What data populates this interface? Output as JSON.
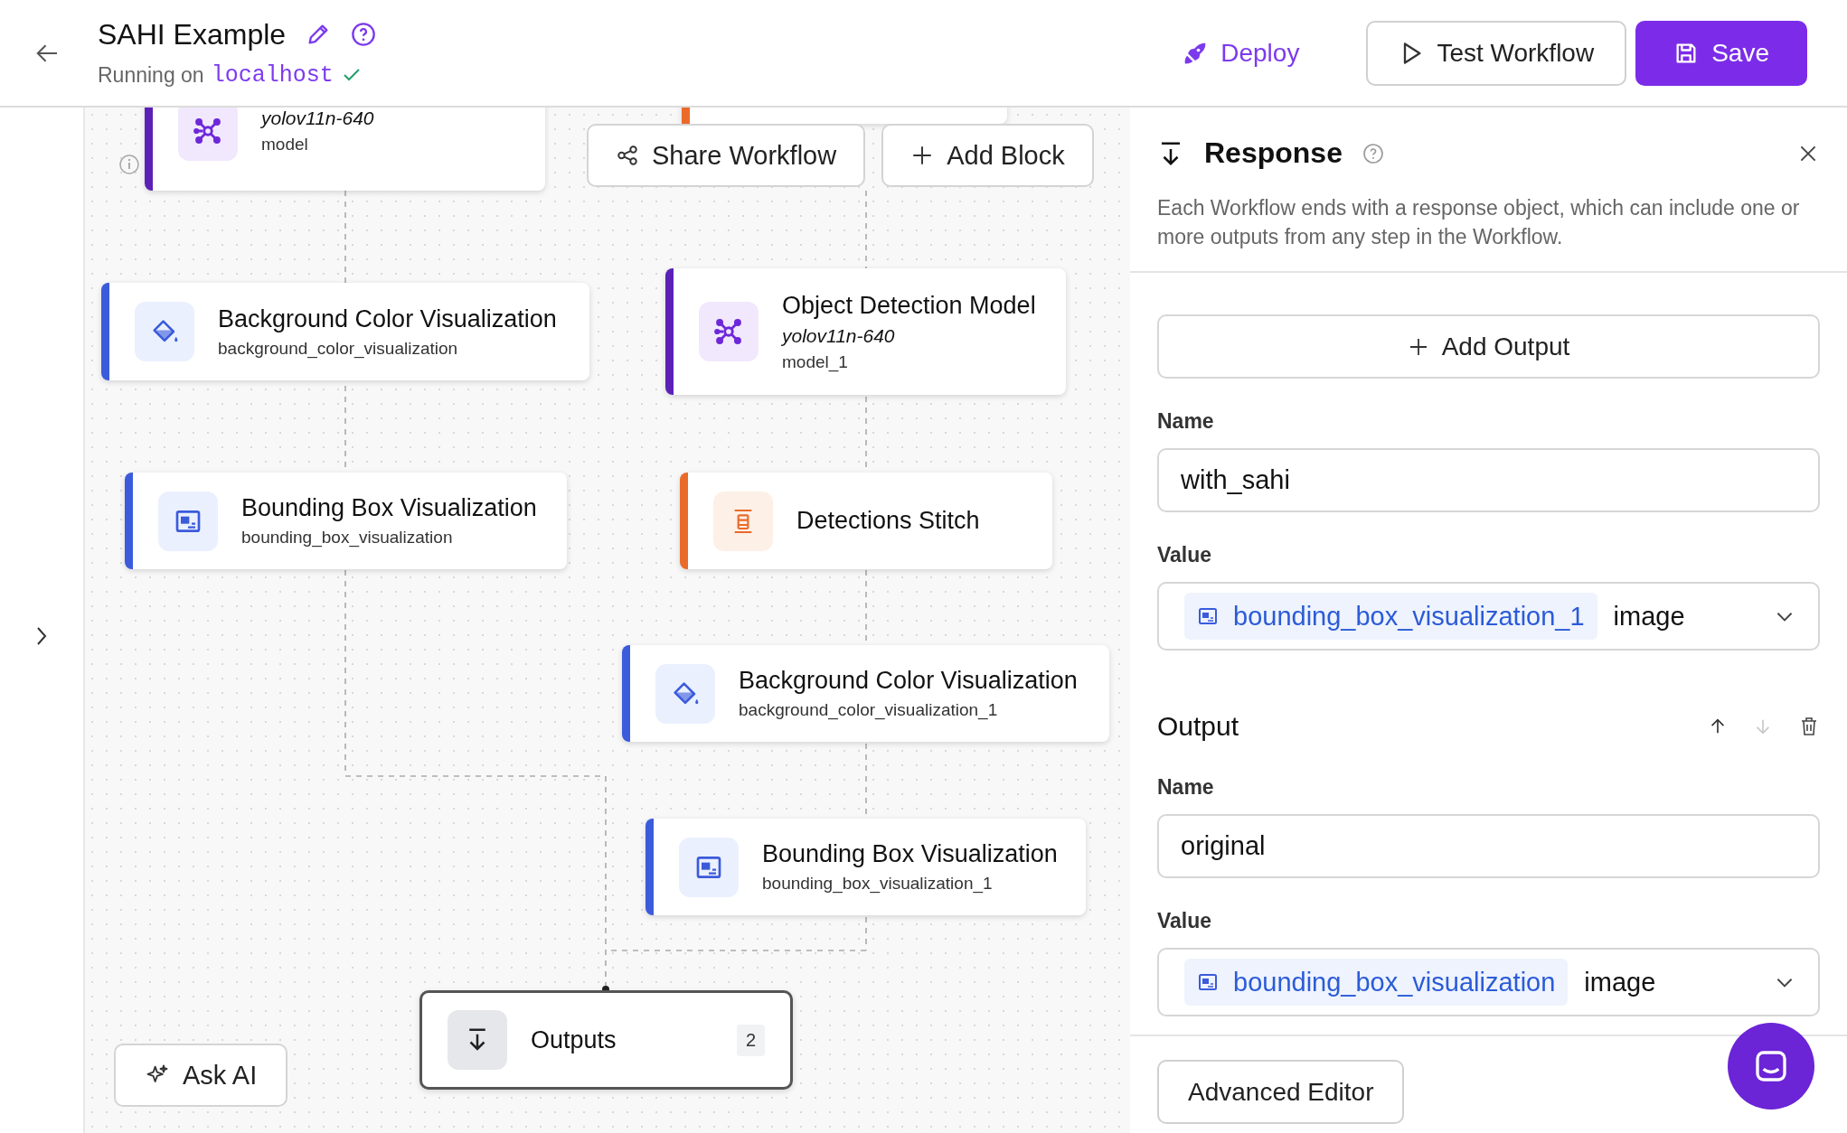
{
  "header": {
    "title": "SAHI Example",
    "status_prefix": "Running on",
    "host": "localhost",
    "connected": true
  },
  "actions": [
    {
      "label": "Deploy",
      "kind": "link"
    },
    {
      "label": "Test Workflow",
      "kind": "outline"
    },
    {
      "label": "Save",
      "kind": "primary"
    }
  ],
  "canvas": {
    "toolbar": [
      "Share Workflow",
      "Add Block"
    ],
    "nodes": [
      {
        "kind": "model",
        "color": "#5b21b6",
        "subtitle": "yolov11n-640",
        "label": "model"
      },
      {
        "kind": "slicer",
        "color": "#ea6a2a"
      },
      {
        "kind": "fill",
        "color": "#3b5bdb",
        "title": "Background Color Visualization",
        "label": "background_color_visualization"
      },
      {
        "kind": "model",
        "color": "#5b21b6",
        "title": "Object Detection Model",
        "subtitle": "yolov11n-640",
        "label": "model_1"
      },
      {
        "kind": "box",
        "color": "#3b5bdb",
        "title": "Bounding Box Visualization",
        "label": "bounding_box_visualization"
      },
      {
        "kind": "stitch",
        "color": "#ea6a2a",
        "title": "Detections Stitch"
      },
      {
        "kind": "fill",
        "color": "#3b5bdb",
        "title": "Background Color Visualization",
        "label": "background_color_visualization_1"
      },
      {
        "kind": "box",
        "color": "#3b5bdb",
        "title": "Bounding Box Visualization",
        "label": "bounding_box_visualization_1"
      },
      {
        "kind": "outputs",
        "title": "Outputs",
        "count": "2"
      }
    ],
    "ask_ai": "Ask AI"
  },
  "panel": {
    "title": "Response",
    "description": "Each Workflow ends with a response object, which can include one or more outputs from any step in the Workflow.",
    "add_output": "Add Output",
    "outputs": [
      {
        "name_label": "Name",
        "name": "with_sahi",
        "value_label": "Value",
        "value_ref": "bounding_box_visualization_1",
        "value_type": "image"
      },
      {
        "heading": "Output",
        "up_disabled": false,
        "down_disabled": true,
        "name_label": "Name",
        "name": "original",
        "value_label": "Value",
        "value_ref": "bounding_box_visualization",
        "value_type": "image"
      }
    ],
    "advanced_editor": "Advanced Editor"
  }
}
